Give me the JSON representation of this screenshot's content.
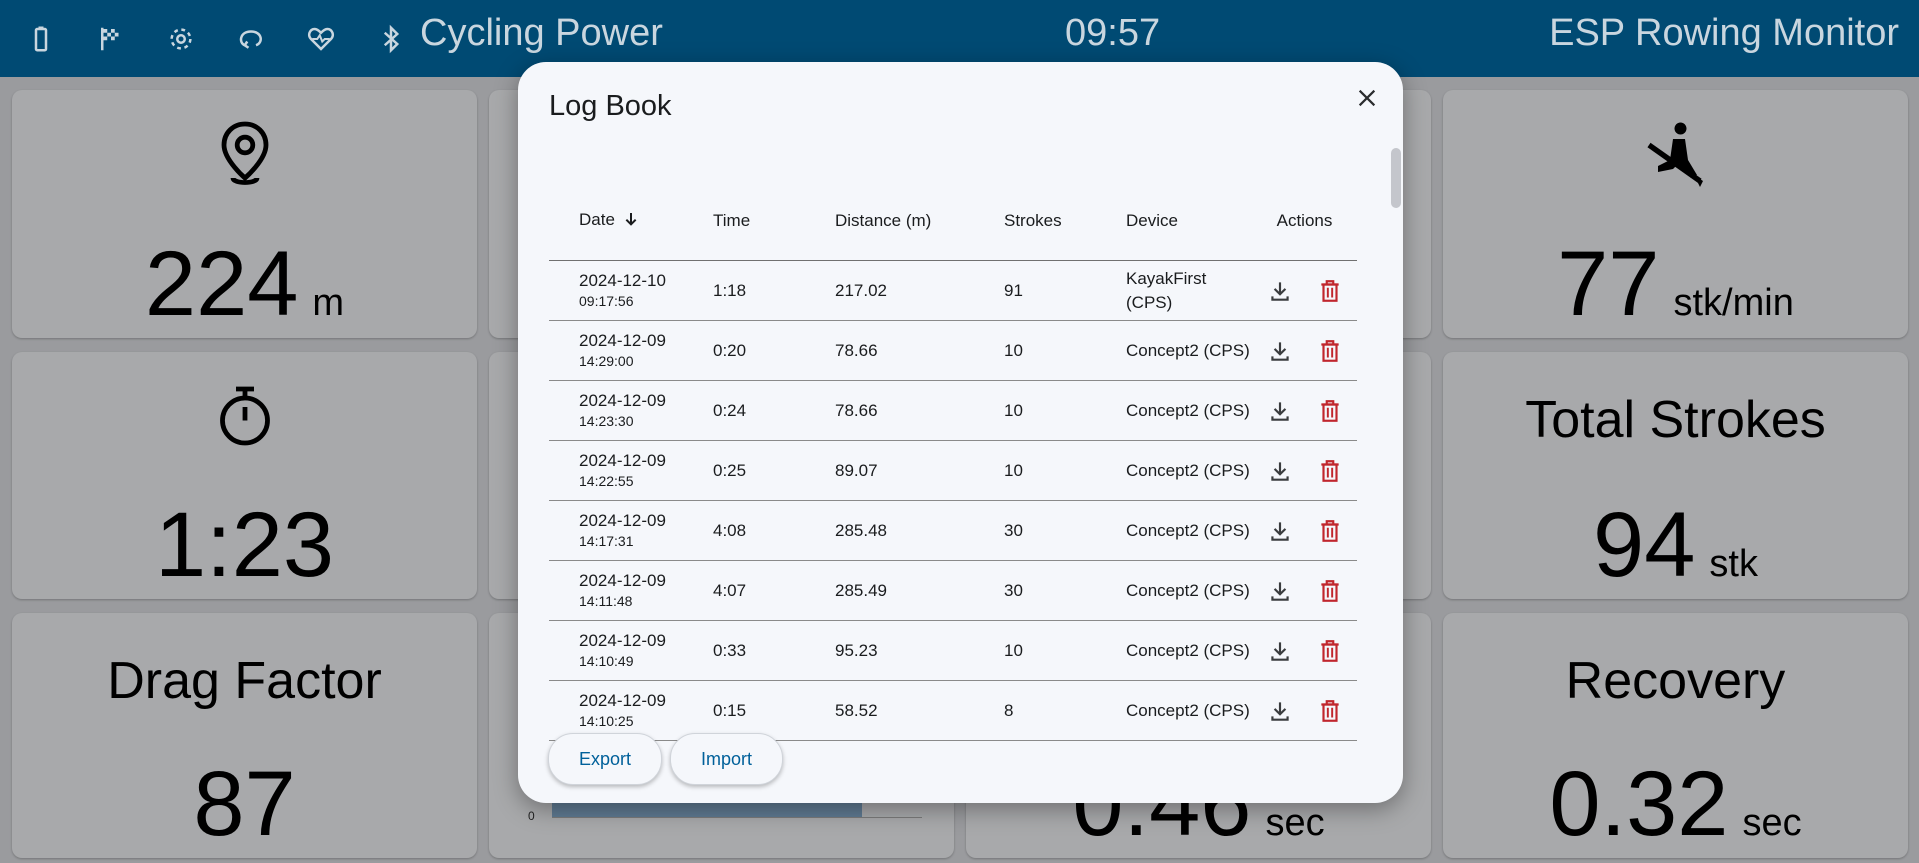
{
  "topbar": {
    "icons": [
      "battery-icon",
      "flag-icon",
      "gear-icon",
      "loop-icon",
      "heart-rate-icon",
      "bluetooth-icon"
    ],
    "mode": "Cycling Power",
    "clock": "09:57",
    "app_title": "ESP Rowing Monitor"
  },
  "tiles": {
    "distance": {
      "value": "224",
      "unit": "m",
      "icon": "location-pin-icon"
    },
    "stroke_rate": {
      "value": "77",
      "unit": "stk/min",
      "icon": "rower-icon"
    },
    "elapsed_time": {
      "value": "1:23",
      "icon": "stopwatch-icon"
    },
    "total_strokes": {
      "label": "Total Strokes",
      "value": "94",
      "unit": "stk"
    },
    "drag_factor": {
      "label": "Drag Factor",
      "value": "87"
    },
    "recovery": {
      "label": "Recovery",
      "value": "0.32",
      "unit": "sec"
    },
    "drive": {
      "value": "0.46",
      "unit": "sec"
    },
    "force_axis_zero": "0"
  },
  "logbook": {
    "title": "Log Book",
    "columns": {
      "date": "Date",
      "time": "Time",
      "distance": "Distance (m)",
      "strokes": "Strokes",
      "device": "Device",
      "actions": "Actions"
    },
    "rows": [
      {
        "date": "2024-12-10",
        "clock": "09:17:56",
        "time": "1:18",
        "distance": "217.02",
        "strokes": "91",
        "device": "KayakFirst (CPS)"
      },
      {
        "date": "2024-12-09",
        "clock": "14:29:00",
        "time": "0:20",
        "distance": "78.66",
        "strokes": "10",
        "device": "Concept2 (CPS)"
      },
      {
        "date": "2024-12-09",
        "clock": "14:23:30",
        "time": "0:24",
        "distance": "78.66",
        "strokes": "10",
        "device": "Concept2 (CPS)"
      },
      {
        "date": "2024-12-09",
        "clock": "14:22:55",
        "time": "0:25",
        "distance": "89.07",
        "strokes": "10",
        "device": "Concept2 (CPS)"
      },
      {
        "date": "2024-12-09",
        "clock": "14:17:31",
        "time": "4:08",
        "distance": "285.48",
        "strokes": "30",
        "device": "Concept2 (CPS)"
      },
      {
        "date": "2024-12-09",
        "clock": "14:11:48",
        "time": "4:07",
        "distance": "285.49",
        "strokes": "30",
        "device": "Concept2 (CPS)"
      },
      {
        "date": "2024-12-09",
        "clock": "14:10:49",
        "time": "0:33",
        "distance": "95.23",
        "strokes": "10",
        "device": "Concept2 (CPS)"
      },
      {
        "date": "2024-12-09",
        "clock": "14:10:25",
        "time": "0:15",
        "distance": "58.52",
        "strokes": "8",
        "device": "Concept2 (CPS)"
      }
    ],
    "export_label": "Export",
    "import_label": "Import"
  },
  "colors": {
    "topbar": "#004a73",
    "delete": "#c0262d",
    "accent": "#00609a"
  }
}
